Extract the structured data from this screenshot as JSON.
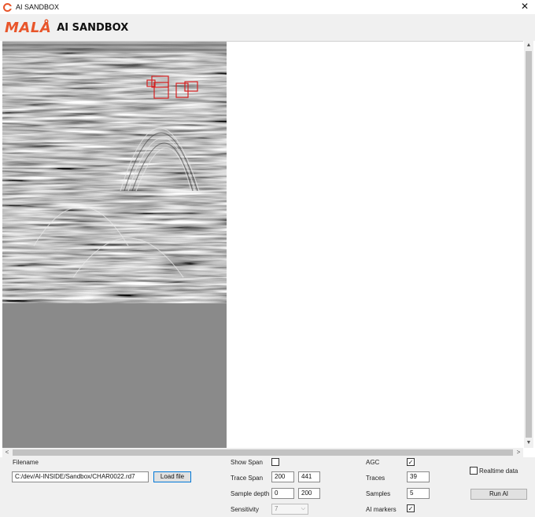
{
  "window": {
    "title": "AI SANDBOX",
    "close_glyph": "✕"
  },
  "header": {
    "logo": "MALÅ",
    "app_name": "AI SANDBOX"
  },
  "scroll": {
    "up": "▲",
    "down": "▼",
    "left": "<",
    "right": ">"
  },
  "controls": {
    "filename_label": "Filename",
    "filename_value": "C:/dev/AI-INSIDE/Sandbox/CHAR0022.rd7",
    "load_button": "Load file",
    "show_span_label": "Show Span",
    "show_span_checked": "",
    "trace_span_label": "Trace Span",
    "trace_span_from": "200",
    "trace_span_to": "441",
    "sample_depth_label": "Sample depth",
    "sample_depth_from": "0",
    "sample_depth_to": "200",
    "sensitivity_label": "Sensitivity",
    "sensitivity_value": "7",
    "sensitivity_caret": "⌵",
    "agc_label": "AGC",
    "agc_checked": "✓",
    "traces_label": "Traces",
    "traces_value": "39",
    "samples_label": "Samples",
    "samples_value": "5",
    "ai_markers_label": "AI markers",
    "ai_markers_checked": "✓",
    "realtime_label": "Realtime data",
    "realtime_checked": "",
    "run_button": "Run AI"
  },
  "colors": {
    "accent": "#e8552a",
    "marker": "#d42020",
    "radar_bg": "#8a8a8a"
  },
  "icons": {
    "app": "app-g-icon",
    "close": "close-icon"
  }
}
